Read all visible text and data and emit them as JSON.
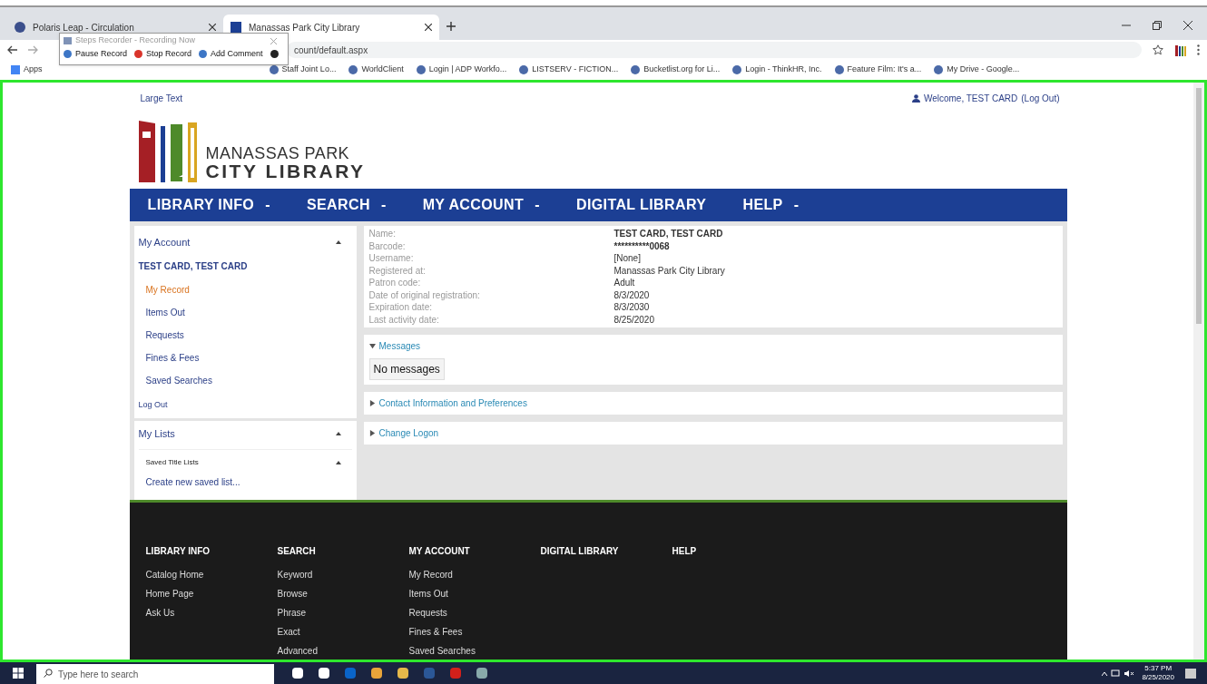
{
  "browser": {
    "tabs": [
      {
        "title": "Polaris Leap - Circulation",
        "selected": false
      },
      {
        "title": "Manassas Park City Library",
        "selected": true
      }
    ],
    "address": "count/default.aspx",
    "bookmarks": [
      "Apps",
      "Staff Joint Lo...",
      "WorldClient",
      "Login | ADP Workfo...",
      "LISTSERV - FICTION...",
      "Bucketlist.org for Li...",
      "Login - ThinkHR, Inc.",
      "Feature Film: It's a...",
      "My Drive - Google..."
    ],
    "recorder": {
      "title": "Steps Recorder - Recording Now",
      "buttons": [
        "Pause Record",
        "Stop Record",
        "Add Comment"
      ]
    }
  },
  "page": {
    "large_text": "Large Text",
    "welcome": "Welcome, TEST CARD",
    "logout": "(Log Out)",
    "logo": {
      "line1": "MANASSAS PARK",
      "line2": "CITY LIBRARY"
    },
    "nav": [
      {
        "label": "LIBRARY INFO",
        "suffix": "-"
      },
      {
        "label": "SEARCH",
        "suffix": "-"
      },
      {
        "label": "MY ACCOUNT",
        "suffix": "-"
      },
      {
        "label": "DIGITAL LIBRARY"
      },
      {
        "label": "HELP",
        "suffix": "-"
      }
    ],
    "sidebar": {
      "account_title": "My Account",
      "patron": "TEST CARD, TEST CARD",
      "items": [
        {
          "label": "My Record",
          "selected": true
        },
        {
          "label": "Items Out",
          "selected": false
        },
        {
          "label": "Requests",
          "selected": false
        },
        {
          "label": "Fines & Fees",
          "selected": false
        },
        {
          "label": "Saved Searches",
          "selected": false
        }
      ],
      "logout": "Log Out",
      "lists_title": "My Lists",
      "saved_title_lists": "Saved Title Lists",
      "create_list": "Create new saved list..."
    },
    "record": [
      {
        "label": "Name:",
        "value": "TEST CARD, TEST CARD",
        "bold": true
      },
      {
        "label": "Barcode:",
        "value": "**********0068",
        "bold": true
      },
      {
        "label": "Username:",
        "value": "[None]",
        "bold": false
      },
      {
        "label": "Registered at:",
        "value": "Manassas Park City Library",
        "bold": false
      },
      {
        "label": "Patron code:",
        "value": "Adult",
        "bold": false
      },
      {
        "label": "Date of original registration:",
        "value": "8/3/2020",
        "bold": false
      },
      {
        "label": "Expiration date:",
        "value": "8/3/2030",
        "bold": false
      },
      {
        "label": "Last activity date:",
        "value": "8/25/2020",
        "bold": false
      }
    ],
    "panels": [
      {
        "title": "Messages",
        "expanded": true,
        "body": "No messages"
      },
      {
        "title": "Contact Information and Preferences",
        "expanded": false
      },
      {
        "title": "Change Logon",
        "expanded": false
      }
    ],
    "footer": [
      {
        "heading": "LIBRARY INFO",
        "links": [
          "Catalog Home",
          "Home Page",
          "Ask Us"
        ]
      },
      {
        "heading": "SEARCH",
        "links": [
          "Keyword",
          "Browse",
          "Phrase",
          "Exact",
          "Advanced"
        ]
      },
      {
        "heading": "MY ACCOUNT",
        "links": [
          "My Record",
          "Items Out",
          "Requests",
          "Fines & Fees",
          "Saved Searches"
        ]
      },
      {
        "heading": "DIGITAL LIBRARY"
      },
      {
        "heading": "HELP"
      }
    ]
  },
  "taskbar": {
    "search_placeholder": "Type here to search",
    "time": "5:37 PM",
    "date": "8/25/2020"
  }
}
